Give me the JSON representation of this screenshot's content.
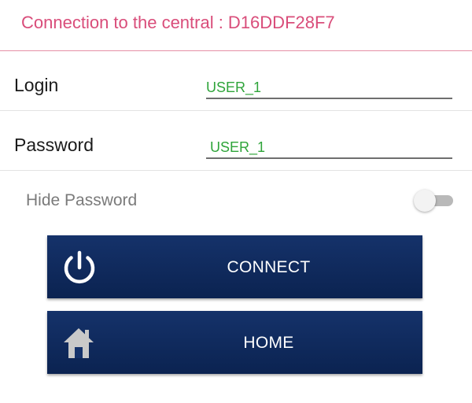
{
  "header": {
    "title": "Connection to the central : D16DDF28F7"
  },
  "login": {
    "label": "Login",
    "value": "USER_1"
  },
  "password": {
    "label": "Password",
    "value": "USER_1"
  },
  "hide_password": {
    "label": "Hide Password",
    "enabled": false
  },
  "buttons": {
    "connect": {
      "label": "CONNECT",
      "icon": "power-icon"
    },
    "home": {
      "label": "HOME",
      "icon": "home-icon"
    }
  },
  "colors": {
    "header_text": "#d94d7a",
    "field_text": "#2fa43a",
    "button_bg": "#0f2a5e"
  }
}
